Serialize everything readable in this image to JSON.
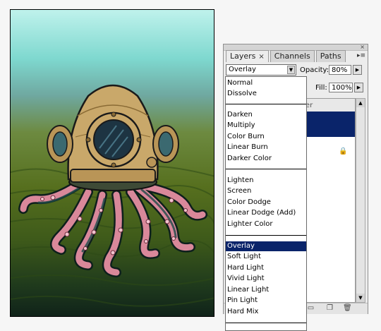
{
  "panel": {
    "tabs": [
      {
        "label": "Layers",
        "close": "×"
      },
      {
        "label": "Channels"
      },
      {
        "label": "Paths"
      }
    ],
    "menu_glyph": "▸≡",
    "opacity_label": "Opacity:",
    "opacity_value": "80%",
    "fill_label": "Fill:",
    "fill_value": "100%",
    "layer_header_fragment": "ver",
    "lock_glyph": "🔒"
  },
  "blend": {
    "current": "Overlay",
    "groups": [
      [
        "Normal",
        "Dissolve"
      ],
      [
        "Darken",
        "Multiply",
        "Color Burn",
        "Linear Burn",
        "Darker Color"
      ],
      [
        "Lighten",
        "Screen",
        "Color Dodge",
        "Linear Dodge (Add)",
        "Lighter Color"
      ],
      [
        "Overlay",
        "Soft Light",
        "Hard Light",
        "Vivid Light",
        "Linear Light",
        "Pin Light",
        "Hard Mix"
      ]
    ],
    "selected": "Overlay"
  },
  "icons": {
    "link": "link-icon",
    "new_layer": "new-layer-icon",
    "trash": "trash-icon",
    "lock": "lock-icon"
  },
  "colors": {
    "selection": "#0a246a",
    "canvas_top": "#bff2ec",
    "canvas_bottom": "#10231a",
    "helmet": "#c9a86a",
    "tentacles": "#d9889a"
  }
}
